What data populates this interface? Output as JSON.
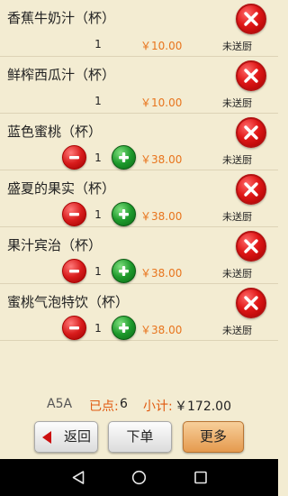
{
  "items": [
    {
      "name": "香蕉牛奶汁（杯）",
      "qty": "1",
      "price": "￥10.00",
      "status": "未送厨",
      "has_stepper": false
    },
    {
      "name": "鲜榨西瓜汁（杯）",
      "qty": "1",
      "price": "￥10.00",
      "status": "未送厨",
      "has_stepper": false
    },
    {
      "name": "蓝色蜜桃（杯）",
      "qty": "1",
      "price": "￥38.00",
      "status": "未送厨",
      "has_stepper": true
    },
    {
      "name": "盛夏的果实（杯）",
      "qty": "1",
      "price": "￥38.00",
      "status": "未送厨",
      "has_stepper": true
    },
    {
      "name": "果汁宾治（杯）",
      "qty": "1",
      "price": "￥38.00",
      "status": "未送厨",
      "has_stepper": true
    },
    {
      "name": "蜜桃气泡特饮（杯）",
      "qty": "1",
      "price": "￥38.00",
      "status": "未送厨",
      "has_stepper": true
    }
  ],
  "summary": {
    "table_no": "A5A",
    "ordered_label": "已点:",
    "ordered_count": "6",
    "subtotal_label": "小计:",
    "subtotal_value": "￥172.00"
  },
  "buttons": {
    "back": "返回",
    "order": "下单",
    "more": "更多"
  },
  "colors": {
    "background": "#f3ecd2",
    "price": "#e8741c",
    "accent_label": "#e05a10",
    "delete": "#e01818",
    "increase": "#1e9a2c"
  },
  "icons": {
    "delete": "close-x-icon",
    "decrease": "minus-icon",
    "increase": "plus-icon",
    "back": "left-arrow-icon",
    "nav_back": "triangle-back-icon",
    "nav_home": "circle-home-icon",
    "nav_recent": "square-recent-icon"
  }
}
